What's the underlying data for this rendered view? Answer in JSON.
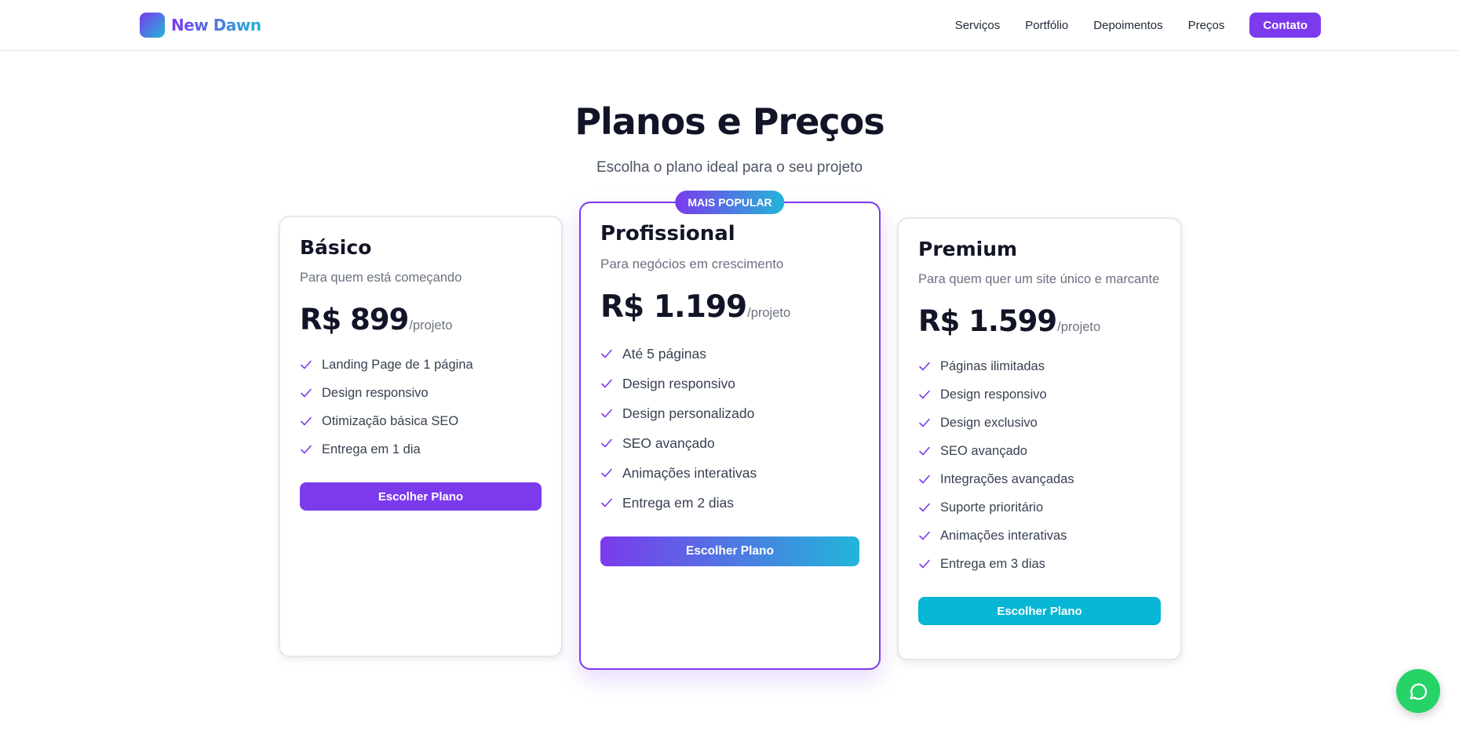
{
  "brand": {
    "name": "New Dawn"
  },
  "nav": {
    "items": [
      {
        "label": "Serviços"
      },
      {
        "label": "Portfólio"
      },
      {
        "label": "Depoimentos"
      },
      {
        "label": "Preços"
      }
    ],
    "cta_label": "Contato"
  },
  "pricing": {
    "title": "Planos e Preços",
    "subtitle": "Escolha o plano ideal para o seu projeto",
    "plans": [
      {
        "name": "Básico",
        "description": "Para quem está começando",
        "price": "R$ 899",
        "period": "/projeto",
        "features": [
          "Landing Page de 1 página",
          "Design responsivo",
          "Otimização básica SEO",
          "Entrega em 1 dia"
        ],
        "button_label": "Escolher Plano",
        "button_color": "#7c3aed"
      },
      {
        "name": "Profissional",
        "badge": "MAIS POPULAR",
        "description": "Para negócios em crescimento",
        "price": "R$ 1.199",
        "period": "/projeto",
        "features": [
          "Até 5 páginas",
          "Design responsivo",
          "Design personalizado",
          "SEO avançado",
          "Animações interativas",
          "Entrega em 2 dias"
        ],
        "button_label": "Escolher Plano"
      },
      {
        "name": "Premium",
        "description": "Para quem quer um site único e marcante",
        "price": "R$ 1.599",
        "period": "/projeto",
        "features": [
          "Páginas ilimitadas",
          "Design responsivo",
          "Design exclusivo",
          "SEO avançado",
          "Integrações avançadas",
          "Suporte prioritário",
          "Animações interativas",
          "Entrega em 3 dias"
        ],
        "button_label": "Escolher Plano",
        "button_color": "#06b6d4"
      }
    ]
  },
  "colors": {
    "primary": "#7c3aed",
    "accent": "#22b5d8",
    "whatsapp": "#25d366",
    "check": "#7c3aed"
  },
  "icons": {
    "feature": "check-icon",
    "chat": "whatsapp-chat-icon",
    "logo": "logo-gradient-square"
  }
}
